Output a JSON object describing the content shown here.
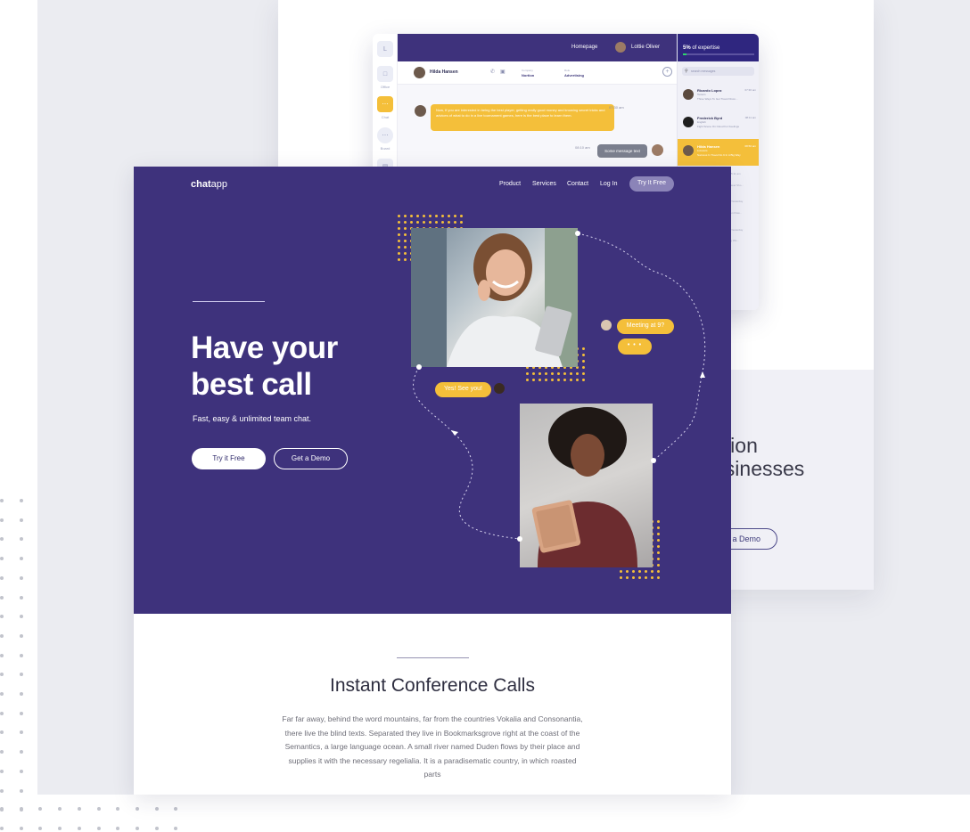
{
  "front": {
    "nav": {
      "logo_bold": "chat",
      "logo_light": "app",
      "links": [
        "Product",
        "Services",
        "Contact",
        "Log In"
      ],
      "cta": "Try It Free"
    },
    "hero": {
      "title": "Have your best call",
      "subtitle": "Fast, easy & unlimited team chat.",
      "primary_button": "Try it Free",
      "secondary_button": "Get a Demo",
      "chip_meeting": "Meeting at 9?",
      "chip_typing": "• • •",
      "chip_reply": "Yes! See you!"
    },
    "section": {
      "title": "Instant Conference Calls",
      "body": "Far far away, behind the word mountains, far from the countries Vokalia and Consonantia, there live the blind texts. Separated they live in Bookmarksgrove right at the coast of the Semantics, a large language ocean. A small river named Duden flows by their place and supplies it with the necessary regelialia. It is a paradisematic country, in which roasted parts"
    }
  },
  "back": {
    "heading_line1": "ation",
    "heading_line2": "usinesses",
    "demo_button": "t a Demo"
  },
  "app": {
    "top": {
      "homepage": "Homepage",
      "user": "Lottie Oliver"
    },
    "progress": {
      "label": "5%",
      "label_suffix": " of expertise",
      "fraction": 0.05
    },
    "sidebar": {
      "labels": [
        "Office",
        "Chat",
        "Board"
      ]
    },
    "chat_header": {
      "name": "Hilda Hansen",
      "field1_label": "Company",
      "field1_value": "Nortion",
      "field2_label": "Role",
      "field2_value": "Advertising"
    },
    "message_in": "Now, If you are interested in being the best player, getting really good money and knowing secret tricks and advices of what to do in a live tournament games, here is the best place to learn them.",
    "message_in_time": "07:30 am",
    "message_out": "Some message text",
    "message_out_time": "08:10 am",
    "search_placeholder": "search messages",
    "contacts": [
      {
        "name": "Ricardo Lopez",
        "role": "Testers",
        "msg": "Three Ways To Get Travel Disco...",
        "time": "07:30 am"
      },
      {
        "name": "Frederick Byrd",
        "role": "English",
        "msg": "Fight Scene On Cloud For Feelings",
        "time": "08:11 am"
      },
      {
        "name": "Hilda Hansen",
        "role": "Lt-lovers",
        "msg": "Success In Travel Do It In A Big Way",
        "time": "08:50 am"
      }
    ],
    "sub_times": [
      "5:11 am",
      "Yesterday",
      "Yesterday"
    ],
    "sub_msgs": [
      "Travel Sho...",
      "own Flow...",
      "ing Wo..."
    ]
  },
  "colors": {
    "brand": "#3e327c",
    "accent": "#f4bf3a"
  }
}
